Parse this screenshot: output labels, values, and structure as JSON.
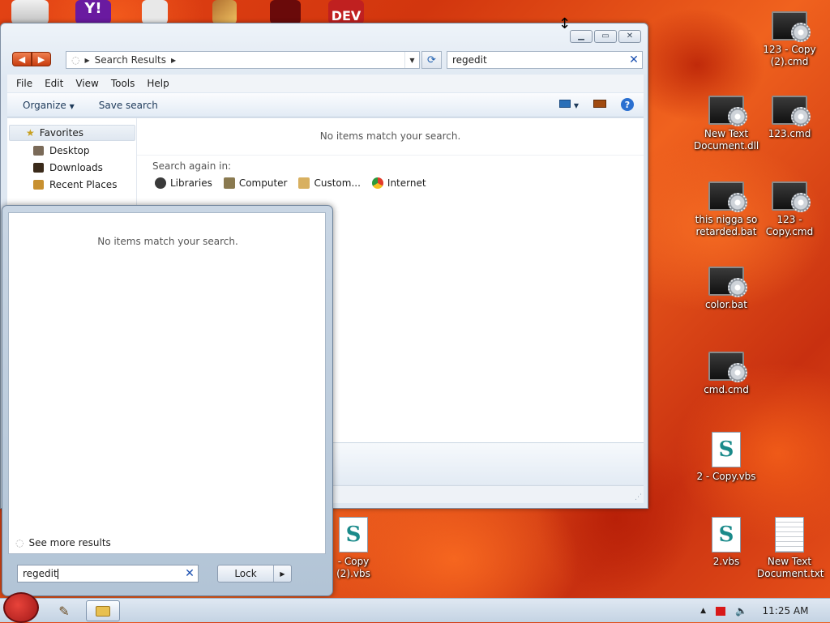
{
  "explorer": {
    "address": "Search Results",
    "search_value": "regedit",
    "menu": [
      "File",
      "Edit",
      "View",
      "Tools",
      "Help"
    ],
    "toolbar": {
      "organize": "Organize",
      "save_search": "Save search"
    },
    "nav": {
      "favorites": "Favorites",
      "items": [
        "Desktop",
        "Downloads",
        "Recent Places"
      ]
    },
    "no_items": "No items match your search.",
    "search_again": {
      "title": "Search again in:",
      "links": [
        "Libraries",
        "Computer",
        "Custom...",
        "Internet"
      ]
    }
  },
  "start_panel": {
    "no_items": "No items match your search.",
    "see_more": "See more results",
    "search_value": "regedit",
    "lock_label": "Lock"
  },
  "desktop_icons": [
    {
      "label": "123 - Copy (2).cmd",
      "type": "cmd"
    },
    {
      "label": "New Text Document.dll",
      "type": "cmd"
    },
    {
      "label": "123.cmd",
      "type": "cmd"
    },
    {
      "label": "this nigga so retarded.bat",
      "type": "cmd"
    },
    {
      "label": "123 - Copy.cmd",
      "type": "cmd"
    },
    {
      "label": "color.bat",
      "type": "cmd"
    },
    {
      "label": "cmd.cmd",
      "type": "cmd"
    },
    {
      "label": "2 - Copy.vbs",
      "type": "vbs"
    },
    {
      "label": "- Copy (2).vbs",
      "type": "vbs"
    },
    {
      "label": "2.vbs",
      "type": "vbs"
    },
    {
      "label": "New Text Document.txt",
      "type": "txt"
    }
  ],
  "top_icons": [
    "Y!",
    "DEV"
  ],
  "taskbar": {
    "clock": "11:25 AM"
  },
  "colors": {
    "accent": "#1a4fb0",
    "nav_arrow": "#d9501c"
  }
}
